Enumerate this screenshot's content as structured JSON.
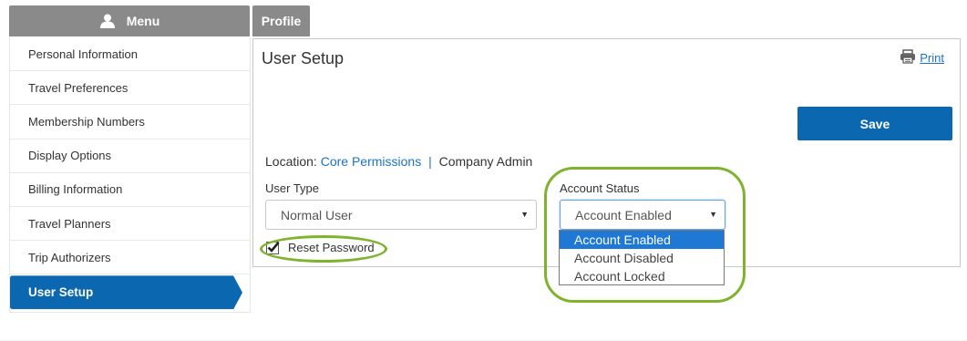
{
  "menu": {
    "title": "Menu",
    "items": [
      {
        "label": "Personal Information",
        "active": false
      },
      {
        "label": "Travel Preferences",
        "active": false
      },
      {
        "label": "Membership Numbers",
        "active": false
      },
      {
        "label": "Display Options",
        "active": false
      },
      {
        "label": "Billing Information",
        "active": false
      },
      {
        "label": "Travel Planners",
        "active": false
      },
      {
        "label": "Trip Authorizers",
        "active": false
      },
      {
        "label": "User Setup",
        "active": true
      }
    ]
  },
  "tabs": {
    "profile": "Profile"
  },
  "panel": {
    "title": "User Setup",
    "print_label": "Print",
    "save_label": "Save",
    "location": {
      "prefix": "Location:",
      "link": "Core Permissions",
      "separator": "|",
      "current": "Company Admin"
    },
    "user_type": {
      "label": "User Type",
      "value": "Normal User"
    },
    "account_status": {
      "label": "Account Status",
      "value": "Account Enabled",
      "options": [
        "Account Enabled",
        "Account Disabled",
        "Account Locked"
      ],
      "selected_index": 0
    },
    "reset_password": {
      "label": "Reset Password",
      "checked": true
    }
  },
  "colors": {
    "brand_blue": "#0b67b0",
    "link_blue": "#1a73c8",
    "tab_gray": "#8a8a8a",
    "highlight_green": "#7fb32e"
  },
  "icons": {
    "menu": "user-icon",
    "print": "printer-icon",
    "dropdown": "chevron-down-icon",
    "checkbox": "checkmark-icon"
  }
}
